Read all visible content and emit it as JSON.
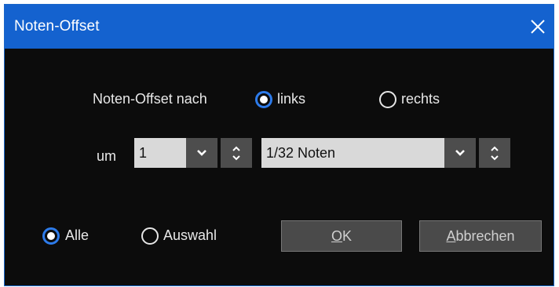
{
  "dialog": {
    "title": "Noten-Offset"
  },
  "direction": {
    "label": "Noten-Offset nach",
    "options": [
      {
        "label": "links",
        "selected": true
      },
      {
        "label": "rechts",
        "selected": false
      }
    ]
  },
  "amount": {
    "prefix": "um",
    "count_value": "1",
    "unit_value": "1/32 Noten"
  },
  "scope": {
    "options": [
      {
        "label": "Alle",
        "selected": true
      },
      {
        "label": "Auswahl",
        "selected": false
      }
    ]
  },
  "buttons": {
    "ok": {
      "mnemonic": "O",
      "rest": "K"
    },
    "cancel": {
      "mnemonic": "A",
      "rest": "bbrechen"
    }
  },
  "icons": {
    "close": "close-icon",
    "dropdown": "chevron-down-icon",
    "spinner": "spin-updown-icon"
  },
  "colors": {
    "titlebar": "#1462cf",
    "background": "#0c0c0c",
    "accent": "#2d7bea",
    "field": "#d9d9d9"
  }
}
